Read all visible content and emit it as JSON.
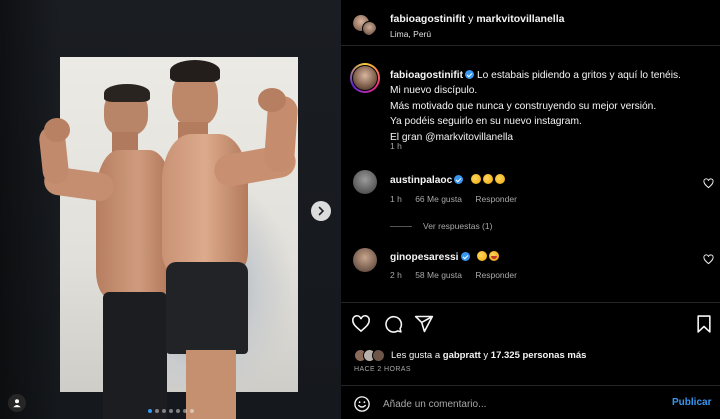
{
  "post": {
    "author": "fabioagostinifit",
    "connector": "y",
    "coauthor": "markvitovillanella",
    "location": "Lima, Perú"
  },
  "caption": {
    "username": "fabioagostinifit",
    "lines": [
      "Lo estabais pidiendo a gritos y aquí lo tenéis.",
      "Mi nuevo discípulo.",
      "Más motivado que nunca y construyendo su mejor versión.",
      "Ya podéis seguirlo en su nuevo instagram.",
      "El gran @markvitovillanella"
    ],
    "time": "1 h"
  },
  "comments": [
    {
      "username": "austinpalaoc",
      "verified": true,
      "emojis": [
        "clap",
        "clap",
        "clap"
      ],
      "time": "1 h",
      "likes": "66 Me gusta",
      "reply": "Responder"
    },
    {
      "username": "ginopesaressi",
      "verified": false,
      "emojis": [
        "clap",
        "grin"
      ],
      "time": "2 h",
      "likes": "58 Me gusta",
      "reply": "Responder"
    }
  ],
  "view_replies": "Ver respuestas (1)",
  "likes": {
    "prefix": "Les gusta a",
    "user": "gabpratt",
    "middle": "y",
    "count": "17.325 personas más"
  },
  "time_ago": "HACE 2 HORAS",
  "comment_box": {
    "placeholder": "Añade un comentario...",
    "publish_label": "Publicar"
  },
  "carousel": {
    "slides": 7,
    "active_index": 0
  },
  "colors": {
    "accent": "#3897f0",
    "background": "#000000",
    "muted": "#a8a8a8"
  },
  "icons": [
    "heart-icon",
    "comment-icon",
    "share-icon",
    "bookmark-icon",
    "smile-icon",
    "chevron-right-icon",
    "user-icon",
    "verified-icon"
  ]
}
